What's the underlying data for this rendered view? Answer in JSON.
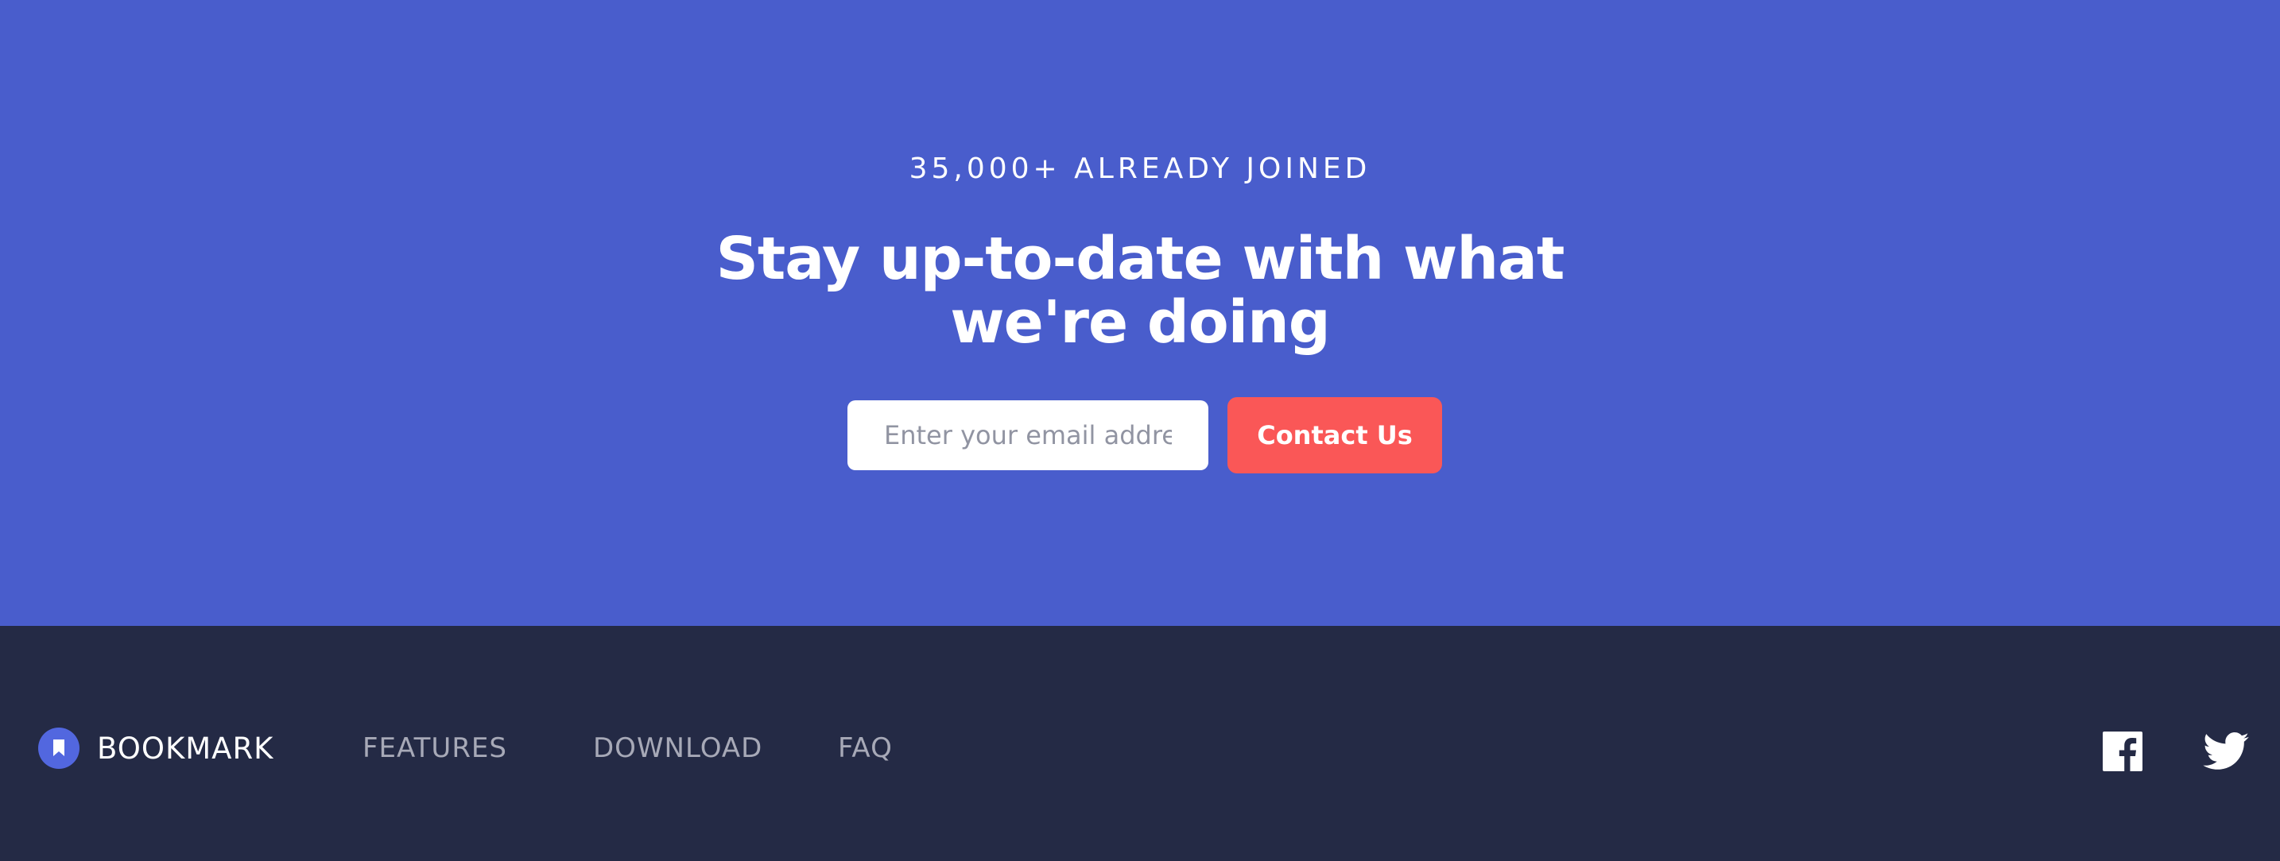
{
  "cta": {
    "eyebrow": "35,000+ ALREADY JOINED",
    "headline": "Stay up-to-date with what we're doing",
    "email_placeholder": "Enter your email address",
    "contact_label": "Contact Us"
  },
  "footer": {
    "logo_text": "BOOKMARK",
    "nav": [
      "FEATURES",
      "DOWNLOAD",
      "FAQ"
    ],
    "social_icons": [
      "facebook-icon",
      "twitter-icon"
    ]
  },
  "colors": {
    "cta_background": "#495DCC",
    "footer_background": "#242A45",
    "accent_red": "#FA5757",
    "brand_blue": "#5267DF",
    "nav_text": "#A7A9B7"
  }
}
